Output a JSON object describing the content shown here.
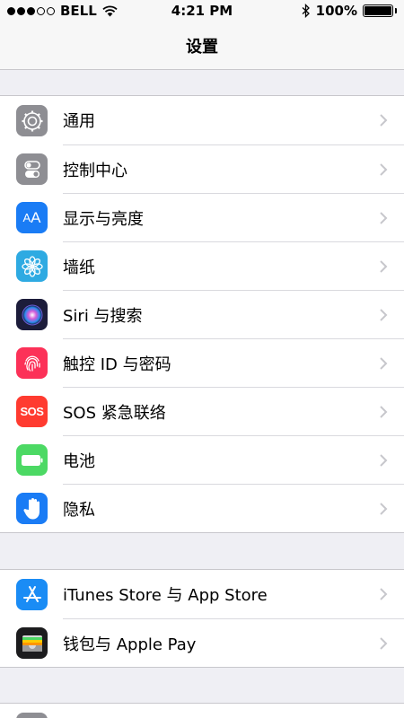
{
  "status": {
    "carrier": "BELL",
    "time": "4:21 PM",
    "battery": "100%",
    "battery_level": 100
  },
  "nav": {
    "title": "设置"
  },
  "groups": [
    {
      "items": [
        {
          "label": "通用",
          "icon": "gear-icon",
          "color": "#8e8e93"
        },
        {
          "label": "控制中心",
          "icon": "toggles-icon",
          "color": "#8e8e93"
        },
        {
          "label": "显示与亮度",
          "icon": "text-size-icon",
          "color": "#1a7cf5"
        },
        {
          "label": "墙纸",
          "icon": "flower-icon",
          "color": "#2eaae2"
        },
        {
          "label": "Siri 与搜索",
          "icon": "siri-icon",
          "color": "#1c1c3a"
        },
        {
          "label": "触控 ID 与密码",
          "icon": "fingerprint-icon",
          "color": "#fc3158"
        },
        {
          "label": "SOS 紧急联络",
          "icon": "sos-icon",
          "color": "#ff3b30",
          "icon_text": "SOS"
        },
        {
          "label": "电池",
          "icon": "battery-icon",
          "color": "#4cd964"
        },
        {
          "label": "隐私",
          "icon": "hand-icon",
          "color": "#1a7cf5"
        }
      ]
    },
    {
      "items": [
        {
          "label": "iTunes Store 与 App Store",
          "icon": "app-store-icon",
          "color": "#1a8cf5"
        },
        {
          "label": "钱包与 Apple Pay",
          "icon": "wallet-icon",
          "color": "#1c1c1e"
        }
      ]
    },
    {
      "items": [
        {
          "label": "",
          "icon": "key-icon",
          "color": "#8e8e93"
        }
      ]
    }
  ]
}
